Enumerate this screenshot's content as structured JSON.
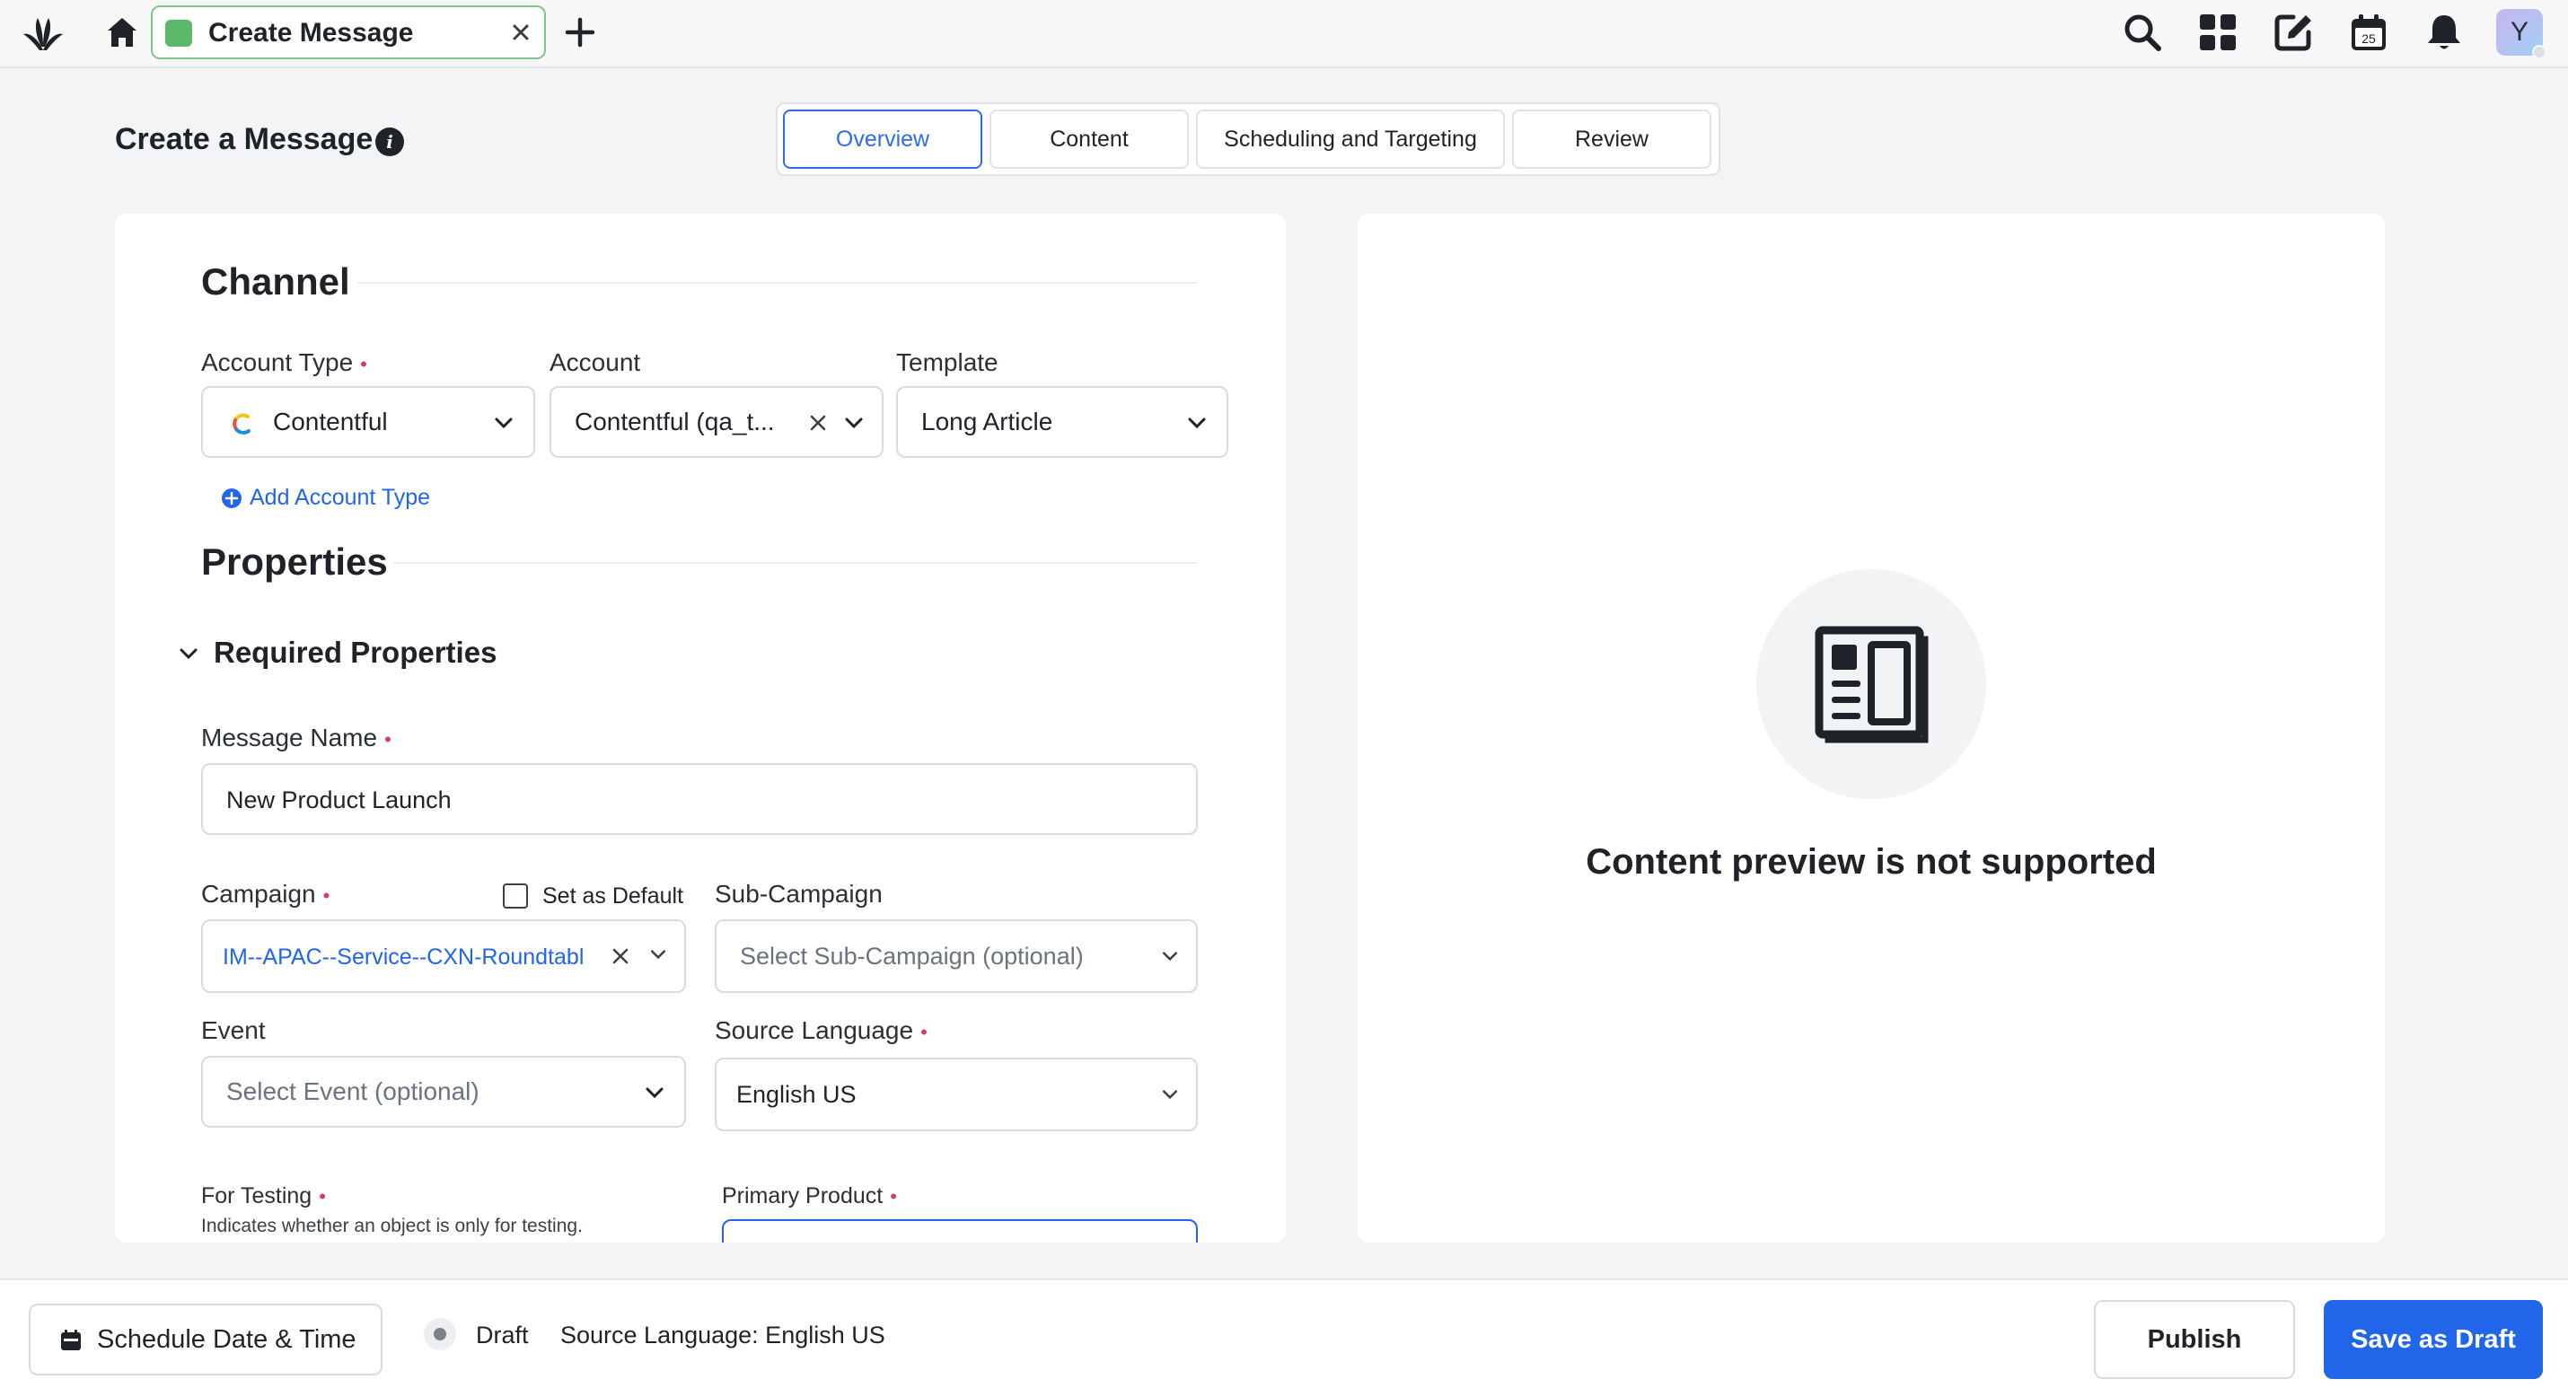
{
  "topbar": {
    "tab_title": "Create Message",
    "calendar_day": "25",
    "avatar_initial": "Y"
  },
  "header": {
    "title": "Create a Message",
    "steps": [
      "Overview",
      "Content",
      "Scheduling and Targeting",
      "Review"
    ],
    "active_step": "Overview"
  },
  "channel": {
    "title": "Channel",
    "account_type_label": "Account Type",
    "account_type_value": "Contentful",
    "account_label": "Account",
    "account_value": "Contentful (qa_t...",
    "template_label": "Template",
    "template_value": "Long Article",
    "add_account_type": "Add Account Type"
  },
  "properties": {
    "title": "Properties",
    "required_title": "Required Properties",
    "message_name_label": "Message Name",
    "message_name_value": "New Product Launch",
    "campaign_label": "Campaign",
    "set_default_label": "Set as Default",
    "campaign_value": "IM--APAC--Service--CXN-Roundtabl",
    "sub_campaign_label": "Sub-Campaign",
    "sub_campaign_placeholder": "Select Sub-Campaign (optional)",
    "event_label": "Event",
    "event_placeholder": "Select Event (optional)",
    "source_language_label": "Source Language",
    "source_language_value": "English US",
    "for_testing_label": "For Testing",
    "for_testing_help": "Indicates whether an object is only for testing.",
    "primary_product_label": "Primary Product"
  },
  "preview": {
    "message": "Content preview is not supported"
  },
  "bottombar": {
    "schedule_label": "Schedule Date & Time",
    "status": "Draft",
    "source_language": "Source Language: English US",
    "publish_label": "Publish",
    "save_draft_label": "Save as Draft"
  },
  "colors": {
    "accent": "#2166e8",
    "required": "#d93b63",
    "tab_border": "#7cc58b"
  }
}
